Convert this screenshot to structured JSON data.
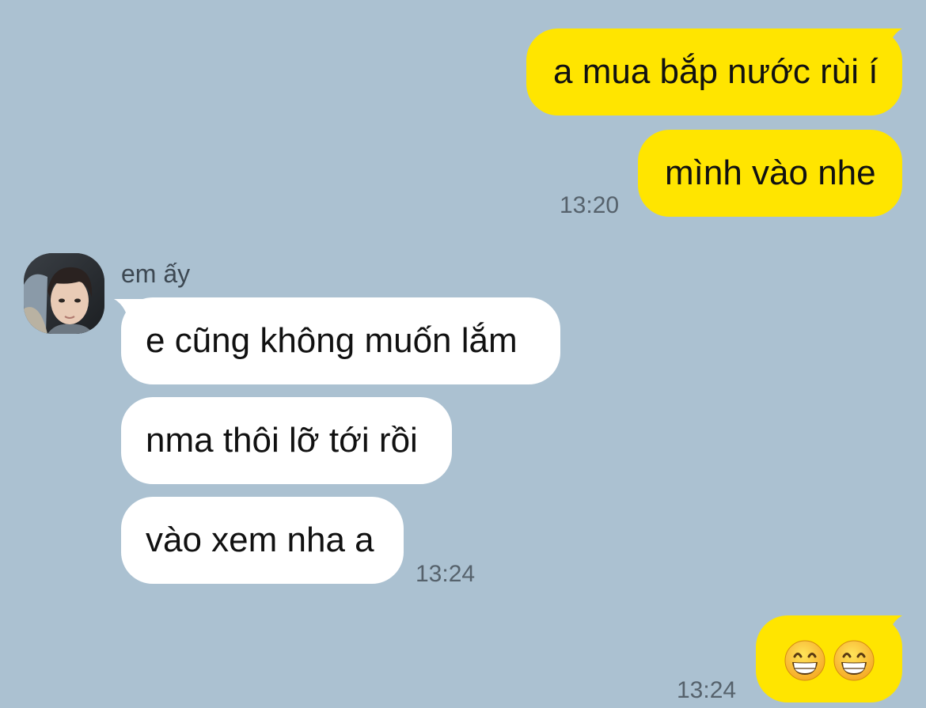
{
  "chat": {
    "contact_name": "em ấy",
    "avatar_icon": "contact-avatar-photo",
    "colors": {
      "background": "#abc1d1",
      "outgoing_bubble": "#ffe500",
      "incoming_bubble": "#ffffff",
      "timestamp": "#56626c"
    },
    "outgoing_group_1": {
      "messages": [
        "a mua bắp nước rùi í",
        "mình vào nhe"
      ],
      "time": "13:20"
    },
    "incoming_group": {
      "messages": [
        "e cũng không muốn lắm",
        "nma thôi lỡ tới rồi",
        "vào xem nha a"
      ],
      "time": "13:24"
    },
    "outgoing_group_2": {
      "emojis": [
        "grinning-face-emoji",
        "grinning-face-emoji"
      ],
      "time": "13:24"
    }
  }
}
